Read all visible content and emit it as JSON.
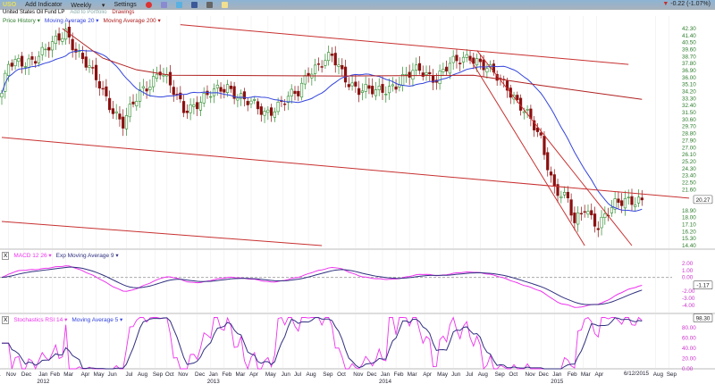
{
  "header": {
    "symbol": "USO",
    "add_indicator": "Add Indicator",
    "interval": "Weekly",
    "settings": "Settings",
    "change": "-0.22 (-1.07%)",
    "icons": [
      "alert-icon",
      "compare-icon",
      "twitter-icon",
      "facebook-icon",
      "print-icon",
      "note-icon"
    ]
  },
  "subheader": {
    "name": "United States Oil Fund LP",
    "add_portfolio": "Add to Portfolio",
    "drawings": "Drawings"
  },
  "price_legend": {
    "price": "Price History ▾",
    "ma20": "Moving Average 20 ▾",
    "ma200": "Moving Average 200 ▾"
  },
  "macd_legend": {
    "close": "X",
    "macd": "MACD 12 26 ▾",
    "ema": "Exp Moving Average 9 ▾"
  },
  "stoch_legend": {
    "close": "X",
    "stoch": "Stochastics RSI 14 ▾",
    "ma": "Moving Average 5 ▾"
  },
  "colors": {
    "up": "#2e8b2e",
    "down": "#8b1010",
    "ma20": "#3344dd",
    "ma200": "#b02020",
    "trend": "#c83030",
    "macd": "#ee33ee",
    "signal": "#303080",
    "axis": "#2e7d2e"
  },
  "chart_data": [
    {
      "type": "candlestick",
      "title": "Price History",
      "interval": "weekly",
      "ylim": [
        14.4,
        42.3
      ],
      "price_ticks": [
        "42.30",
        "41.40",
        "40.50",
        "39.60",
        "38.70",
        "37.80",
        "36.90",
        "36.00",
        "35.10",
        "34.20",
        "33.30",
        "32.40",
        "31.50",
        "30.60",
        "29.70",
        "28.80",
        "27.90",
        "27.00",
        "26.10",
        "25.20",
        "24.30",
        "23.40",
        "22.50",
        "21.60",
        "20.70",
        "19.80",
        "18.90",
        "18.00",
        "17.10",
        "16.20",
        "15.30",
        "14.40"
      ],
      "last_price": "20.27",
      "close_keypoints": [
        [
          0,
          34
        ],
        [
          2,
          37.5
        ],
        [
          7,
          38
        ],
        [
          11,
          39
        ],
        [
          15,
          40
        ],
        [
          19,
          42
        ],
        [
          23,
          39
        ],
        [
          29,
          35
        ],
        [
          33,
          32
        ],
        [
          36,
          30
        ],
        [
          41,
          34
        ],
        [
          47,
          37
        ],
        [
          51,
          34
        ],
        [
          54,
          32
        ],
        [
          59,
          33
        ],
        [
          67,
          35
        ],
        [
          72,
          33
        ],
        [
          78,
          31.5
        ],
        [
          84,
          33
        ],
        [
          88,
          34
        ],
        [
          91,
          37
        ],
        [
          98,
          38.5
        ],
        [
          102,
          36
        ],
        [
          106,
          34.5
        ],
        [
          111,
          34
        ],
        [
          118,
          35.5
        ],
        [
          124,
          37
        ],
        [
          129,
          36
        ],
        [
          133,
          37.5
        ],
        [
          139,
          39
        ],
        [
          144,
          37
        ],
        [
          150,
          35
        ],
        [
          156,
          31
        ],
        [
          160,
          28
        ],
        [
          164,
          22
        ],
        [
          168,
          20
        ],
        [
          170,
          17
        ],
        [
          173,
          19.5
        ],
        [
          177,
          17
        ],
        [
          182,
          19.5
        ],
        [
          185,
          20.5
        ],
        [
          190,
          20.27
        ]
      ],
      "ma200_keypoints": [
        [
          18,
          42.3
        ],
        [
          30,
          38.5
        ],
        [
          40,
          37
        ],
        [
          50,
          36.3
        ],
        [
          100,
          36.2
        ],
        [
          140,
          36.3
        ],
        [
          160,
          35
        ],
        [
          190,
          33.2
        ]
      ],
      "trendlines": [
        [
          [
            53,
            42.8
          ],
          [
            186,
            37.7
          ]
        ],
        [
          [
            0,
            28.3
          ],
          [
            204,
            20.5
          ]
        ],
        [
          [
            0,
            17.5
          ],
          [
            95,
            14.4
          ]
        ],
        [
          [
            139,
            38.4
          ],
          [
            173,
            14.4
          ]
        ],
        [
          [
            141,
            39.5
          ],
          [
            187,
            14.4
          ]
        ]
      ]
    },
    {
      "type": "line",
      "title": "MACD 12 26",
      "series": [
        "MACD",
        "Exp Moving Average 9"
      ],
      "ticks": [
        "2.00",
        "1.00",
        "0.00",
        "-2.00",
        "-3.00",
        "-4.00"
      ],
      "last_value": "-1.17",
      "ylim": [
        -4.8,
        2.6
      ]
    },
    {
      "type": "line",
      "title": "Stochastics RSI 14",
      "series": [
        "StochRSI",
        "Moving Average 5"
      ],
      "ticks": [
        "80.00",
        "60.00",
        "40.00",
        "20.00",
        "0.00"
      ],
      "last_value": "98.30",
      "ylim": [
        0,
        100
      ]
    }
  ],
  "x_axis": {
    "months": [
      [
        "11",
        -2
      ],
      [
        "Nov",
        2
      ],
      [
        "Dec",
        6.5
      ],
      [
        "Jan",
        11.5
      ],
      [
        "Feb",
        15
      ],
      [
        "Mar",
        19
      ],
      [
        "Apr",
        24
      ],
      [
        "May",
        28
      ],
      [
        "Jun",
        32
      ],
      [
        "Jul",
        37
      ],
      [
        "Aug",
        41
      ],
      [
        "Sep",
        45.5
      ],
      [
        "Oct",
        49
      ],
      [
        "Nov",
        53
      ],
      [
        "Dec",
        58
      ],
      [
        "Jan",
        62
      ],
      [
        "Feb",
        66
      ],
      [
        "Mar",
        70
      ],
      [
        "Apr",
        74
      ],
      [
        "May",
        79
      ],
      [
        "Jun",
        83.5
      ],
      [
        "Jul",
        87
      ],
      [
        "Aug",
        91
      ],
      [
        "Sep",
        96
      ],
      [
        "Oct",
        100
      ],
      [
        "Nov",
        105
      ],
      [
        "Dec",
        109
      ],
      [
        "Jan",
        113
      ],
      [
        "Feb",
        117
      ],
      [
        "Mar",
        121
      ],
      [
        "Apr",
        125.5
      ],
      [
        "May",
        130
      ],
      [
        "Jun",
        134
      ],
      [
        "Jul",
        138
      ],
      [
        "Aug",
        142
      ],
      [
        "Sep",
        147
      ],
      [
        "Oct",
        151
      ],
      [
        "Nov",
        156
      ],
      [
        "Dec",
        160
      ],
      [
        "Jan",
        164
      ],
      [
        "Feb",
        168.5
      ],
      [
        "Mar",
        172.5
      ],
      [
        "Apr",
        176.5
      ],
      [
        "Aug",
        194
      ],
      [
        "Sep",
        198
      ]
    ],
    "years": [
      [
        "2012",
        11.5
      ],
      [
        "2013",
        62
      ],
      [
        "2014",
        113
      ],
      [
        "2015",
        164
      ]
    ],
    "current_date": "6/12/2015"
  }
}
